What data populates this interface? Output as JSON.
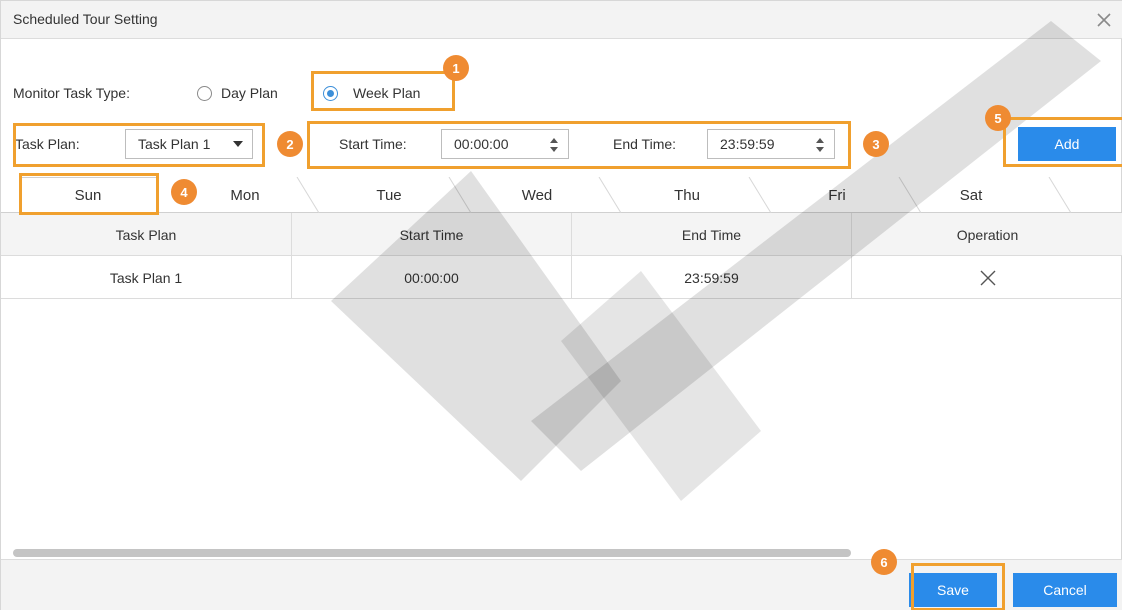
{
  "window": {
    "title": "Scheduled Tour Setting",
    "close_icon": "close-icon"
  },
  "monitor_task": {
    "label": "Monitor Task Type:",
    "options": [
      {
        "label": "Day Plan",
        "checked": false
      },
      {
        "label": "Week Plan",
        "checked": true
      }
    ]
  },
  "task_plan": {
    "label": "Task Plan:",
    "value": "Task Plan 1"
  },
  "start_time": {
    "label": "Start Time:",
    "value": "00:00:00"
  },
  "end_time": {
    "label": "End Time:",
    "value": "23:59:59"
  },
  "add_label": "Add",
  "tabs": [
    {
      "label": "Sun",
      "active": true
    },
    {
      "label": "Mon"
    },
    {
      "label": "Tue"
    },
    {
      "label": "Wed"
    },
    {
      "label": "Thu"
    },
    {
      "label": "Fri"
    },
    {
      "label": "Sat"
    }
  ],
  "table": {
    "headers": [
      "Task Plan",
      "Start Time",
      "End Time",
      "Operation"
    ],
    "rows": [
      {
        "task_plan": "Task Plan 1",
        "start_time": "00:00:00",
        "end_time": "23:59:59",
        "operation": "delete-icon"
      }
    ]
  },
  "footer": {
    "save_label": "Save",
    "cancel_label": "Cancel"
  },
  "callouts": [
    "1",
    "2",
    "3",
    "4",
    "5",
    "6"
  ],
  "colors": {
    "accent": "#2a8bea",
    "highlight": "#f0a02e",
    "badge": "#ef8b32"
  }
}
